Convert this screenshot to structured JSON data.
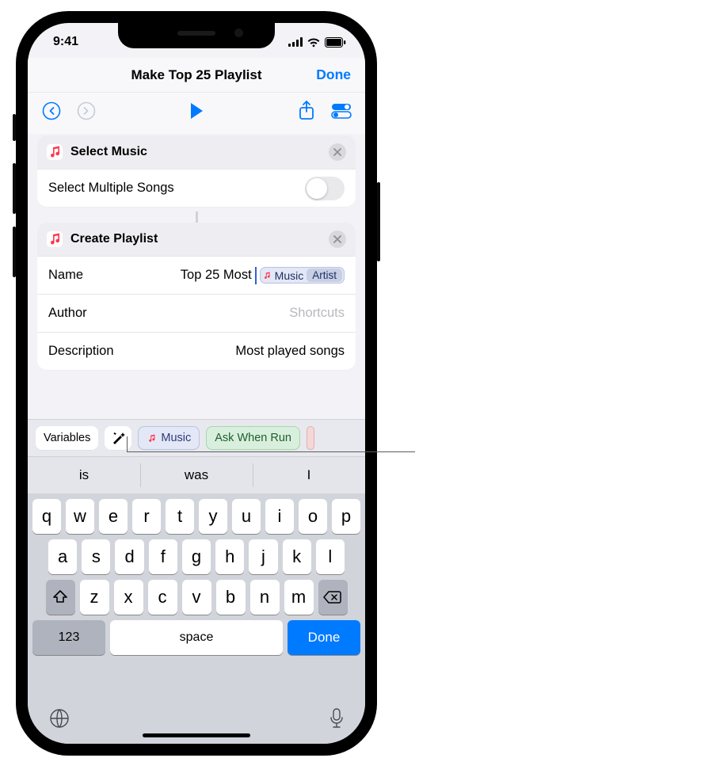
{
  "status": {
    "time": "9:41"
  },
  "nav": {
    "title": "Make Top 25 Playlist",
    "done": "Done"
  },
  "cards": {
    "select": {
      "title": "Select Music",
      "row_label": "Select Multiple Songs"
    },
    "create": {
      "title": "Create Playlist",
      "name_label": "Name",
      "name_value": "Top 25 Most",
      "name_token_main": "Music",
      "name_token_sub": "Artist",
      "author_label": "Author",
      "author_placeholder": "Shortcuts",
      "desc_label": "Description",
      "desc_value": "Most played songs"
    }
  },
  "accessory": {
    "variables": "Variables",
    "music": "Music",
    "ask": "Ask When Run"
  },
  "suggestions": [
    "is",
    "was",
    "I"
  ],
  "keyboard": {
    "rows": [
      [
        "q",
        "w",
        "e",
        "r",
        "t",
        "y",
        "u",
        "i",
        "o",
        "p"
      ],
      [
        "a",
        "s",
        "d",
        "f",
        "g",
        "h",
        "j",
        "k",
        "l"
      ],
      [
        "z",
        "x",
        "c",
        "v",
        "b",
        "n",
        "m"
      ]
    ],
    "n123": "123",
    "space": "space",
    "done": "Done"
  }
}
